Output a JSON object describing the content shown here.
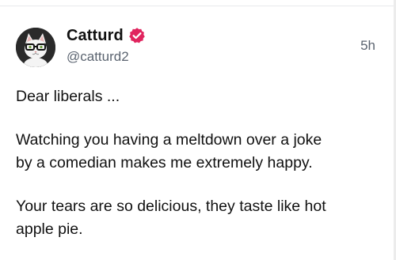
{
  "post": {
    "author": {
      "display_name": "Catturd",
      "handle": "@catturd2",
      "verified": true,
      "avatar_icon": "cat-with-glasses-avatar"
    },
    "timestamp": "5h",
    "body": {
      "line1": "Dear liberals ...",
      "para2_line1": "Watching you having a meltdown over a joke",
      "para2_line2": "by a comedian makes me extremely happy.",
      "para3_line1": "Your tears are so delicious, they taste like hot",
      "para3_line2": "apple pie."
    }
  },
  "colors": {
    "verified_badge": "#e0245e",
    "text_primary": "#111111",
    "text_secondary": "#5b6470",
    "divider": "#e7e9ec"
  }
}
